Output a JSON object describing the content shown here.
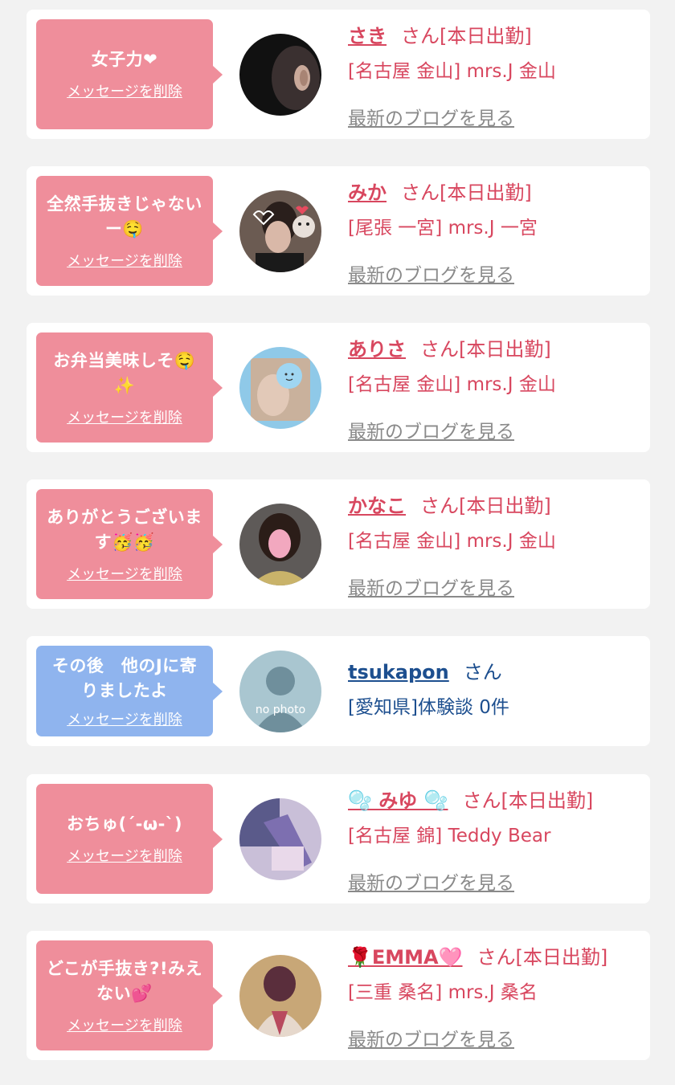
{
  "colors": {
    "page_bg": "#f2f2f2",
    "card_bg": "#ffffff",
    "bubble_pink": "#ef8e9b",
    "bubble_blue": "#8fb4ee",
    "name_red": "#d8475f",
    "name_navy": "#1d4f8f",
    "blog_gray": "#8a8a8a"
  },
  "common": {
    "delete_label": "メッセージを削除",
    "blog_label": "最新のブログを見る",
    "honorific": "さん"
  },
  "items": [
    {
      "message": "女子力❤",
      "name": "さき",
      "status": "[本日出勤]",
      "shop": "[名古屋 金山] mrs.J 金山",
      "bubble": "pink",
      "avatar_icon": "avatar-photo-dark"
    },
    {
      "message": "全然手抜きじゃないー🤤",
      "name": "みか",
      "status": "[本日出勤]",
      "shop": "[尾張 一宮] mrs.J 一宮",
      "bubble": "pink",
      "avatar_icon": "avatar-photo-cat-stickers"
    },
    {
      "message": "お弁当美味しそ🤤✨",
      "name": "ありさ",
      "status": "[本日出勤]",
      "shop": "[名古屋 金山] mrs.J 金山",
      "bubble": "pink",
      "avatar_icon": "avatar-photo-blue-face"
    },
    {
      "message": "ありがとうございます🥳🥳",
      "name": "かなこ",
      "status": "[本日出勤]",
      "shop": "[名古屋 金山] mrs.J 金山",
      "bubble": "pink",
      "avatar_icon": "avatar-photo-pink-face"
    },
    {
      "message": "その後　他のJに寄りましたよ",
      "name": "tsukapon",
      "status": "",
      "shop": "[愛知県]体験談 0件",
      "bubble": "blue",
      "avatar_icon": "avatar-no-photo",
      "avatar_text": "no photo"
    },
    {
      "message": "おちゅ(´-ω-`)",
      "name": "🫧 みゆ 🫧",
      "status": "[本日出勤]",
      "shop": "[名古屋 錦] Teddy Bear",
      "bubble": "pink",
      "avatar_icon": "avatar-photo-purple"
    },
    {
      "message": "どこが手抜き?!みえない💕",
      "name": "🌹EMMA🩷",
      "status": "[本日出勤]",
      "shop": "[三重 桑名] mrs.J 桑名",
      "bubble": "pink",
      "avatar_icon": "avatar-photo-kimono"
    }
  ]
}
